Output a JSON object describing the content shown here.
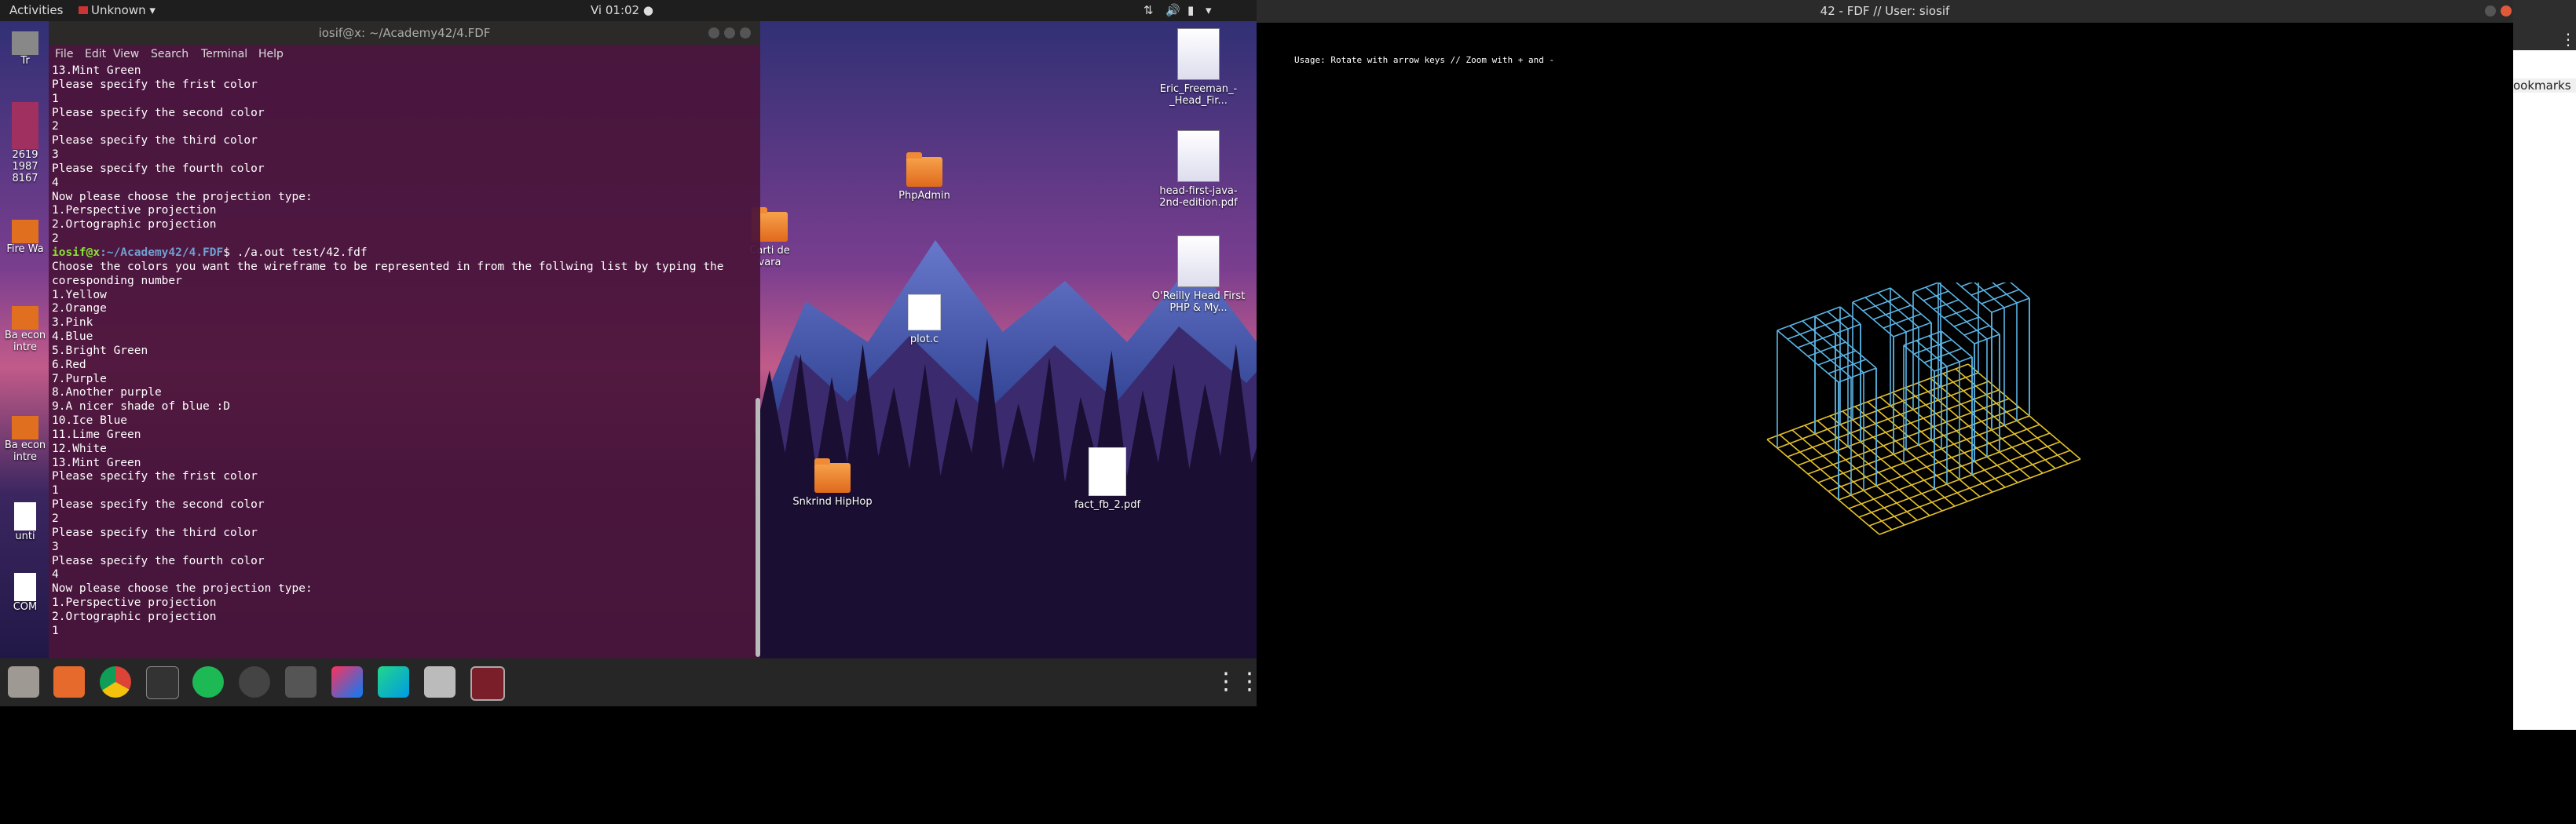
{
  "topbar": {
    "activities": "Activities",
    "app_menu": "Unknown",
    "clock": "Vi 01:02 ●"
  },
  "terminal": {
    "title": "iosif@x: ~/Academy42/4.FDF",
    "menu": [
      "File",
      "Edit",
      "View",
      "Search",
      "Terminal",
      "Help"
    ],
    "lines_before": [
      "13.Mint Green",
      "Please specify the frist color",
      "1",
      "Please specify the second color",
      "2",
      "Please specify the third color",
      "3",
      "Please specify the fourth color",
      "4",
      "Now please choose the projection type:",
      "1.Perspective projection",
      "2.Ortographic projection",
      "2"
    ],
    "prompt_user": "iosif@x",
    "prompt_path": ":~/Academy42/4.FDF",
    "prompt_cmd": "$ ./a.out test/42.fdf",
    "lines_after": [
      "Choose the colors you want the wireframe to be represented in from the follwing list by typing the",
      "coresponding number",
      "1.Yellow",
      "2.Orange",
      "3.Pink",
      "4.Blue",
      "5.Bright Green",
      "6.Red",
      "7.Purple",
      "8.Another purple",
      "9.A nicer shade of blue :D",
      "10.Ice Blue",
      "11.Lime Green",
      "12.White",
      "13.Mint Green",
      "Please specify the frist color",
      "1",
      "Please specify the second color",
      "2",
      "Please specify the third color",
      "3",
      "Please specify the fourth color",
      "4",
      "Now please choose the projection type:",
      "1.Perspective projection",
      "2.Ortographic projection",
      "1"
    ]
  },
  "desktop": {
    "icons": [
      {
        "label": "PhpAdmin",
        "type": "folder"
      },
      {
        "label": "Carti de vara",
        "type": "folder"
      },
      {
        "label": "plot.c",
        "type": "doc"
      },
      {
        "label": "Snkrind HipHop",
        "type": "folder"
      },
      {
        "label": "fact_fb_2.pdf",
        "type": "doc"
      },
      {
        "label": "Eric_Freeman_-_Head_Fir...",
        "type": "book"
      },
      {
        "label": "head-first-java-2nd-edition.pdf",
        "type": "book"
      },
      {
        "label": "O'Reilly Head First PHP & My...",
        "type": "book"
      }
    ],
    "partial_labels": [
      "Tr",
      "2619 1987 8167",
      "Fire Wa",
      "Ba econ intre",
      "Ba econ intre",
      "unti",
      "COM"
    ]
  },
  "fdf": {
    "title": "42 - FDF // User: siosif",
    "usage": "Usage: Rotate with arrow keys // Zoom with + and -"
  },
  "browser": {
    "bookmarks_fragment": "ookmarks"
  },
  "colors": {
    "terminal_bg": "#4a143a",
    "yellow_grid": "#e3c02c",
    "blue_grid": "#5ab4e5"
  }
}
